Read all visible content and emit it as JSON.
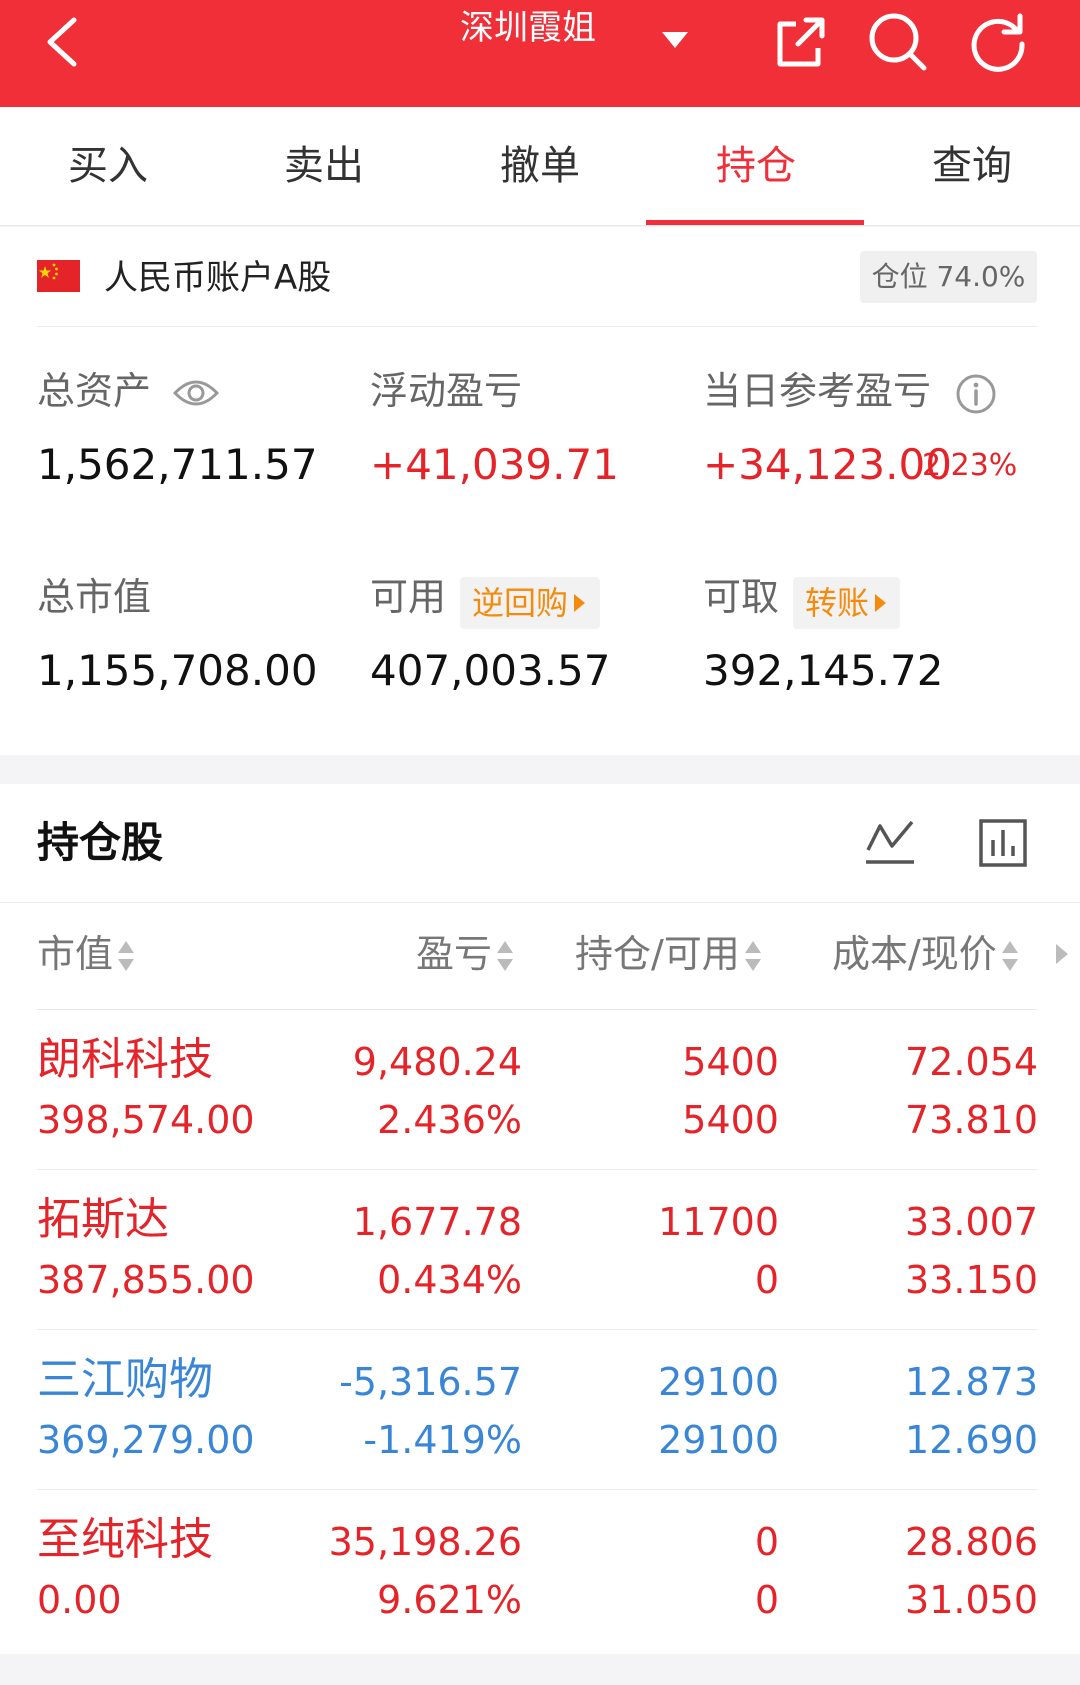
{
  "header": {
    "title": "深圳霞姐",
    "icons": [
      "back-icon",
      "dropdown-icon",
      "share-icon",
      "search-icon",
      "refresh-icon"
    ]
  },
  "tabs": [
    {
      "label": "买入"
    },
    {
      "label": "卖出"
    },
    {
      "label": "撤单"
    },
    {
      "label": "持仓",
      "active": true
    },
    {
      "label": "查询"
    }
  ],
  "account": {
    "name": "人民币账户A股",
    "position_ratio": "仓位 74.0%",
    "total_assets_label": "总资产",
    "total_assets": "1,562,711.57",
    "floating_pl_label": "浮动盈亏",
    "floating_pl": "+41,039.71",
    "daily_pl_label": "当日参考盈亏",
    "daily_pl": "+34,123.00",
    "daily_pl_pct": "2.23%",
    "market_value_label": "总市值",
    "market_value": "1,155,708.00",
    "available_label": "可用",
    "available": "407,003.57",
    "reverse_repo_label": "逆回购",
    "withdrawable_label": "可取",
    "withdrawable": "392,145.72",
    "transfer_label": "转账"
  },
  "holdings": {
    "title": "持仓股",
    "columns": {
      "market_value": "市值",
      "profit_loss": "盈亏",
      "position_available": "持仓/可用",
      "cost_price": "成本/现价"
    },
    "rows": [
      {
        "name": "朗科科技",
        "market_value": "398,574.00",
        "pl": "9,480.24",
        "pl_pct": "2.436%",
        "position": "5400",
        "available": "5400",
        "cost": "72.054",
        "price": "73.810",
        "trend": "up"
      },
      {
        "name": "拓斯达",
        "market_value": "387,855.00",
        "pl": "1,677.78",
        "pl_pct": "0.434%",
        "position": "11700",
        "available": "0",
        "cost": "33.007",
        "price": "33.150",
        "trend": "up"
      },
      {
        "name": "三江购物",
        "market_value": "369,279.00",
        "pl": "-5,316.57",
        "pl_pct": "-1.419%",
        "position": "29100",
        "available": "29100",
        "cost": "12.873",
        "price": "12.690",
        "trend": "down"
      },
      {
        "name": "至纯科技",
        "market_value": "0.00",
        "pl": "35,198.26",
        "pl_pct": "9.621%",
        "position": "0",
        "available": "0",
        "cost": "28.806",
        "price": "31.050",
        "trend": "up"
      }
    ]
  },
  "colors": {
    "brand_red": "#f02f38",
    "up_red": "#e5242a",
    "down_blue": "#3a86d6",
    "accent_orange": "#f58b0d"
  }
}
